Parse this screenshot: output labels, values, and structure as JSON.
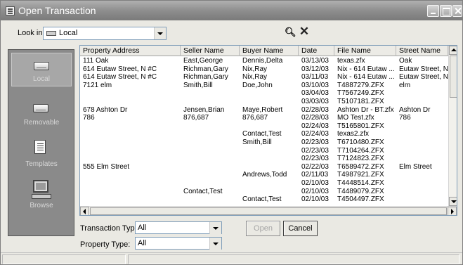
{
  "window": {
    "title": "Open Transaction"
  },
  "toolbar": {
    "lookin_label": "Look in:",
    "lookin_value": "Local",
    "find_icon": "binoculars-icon",
    "delete_icon": "delete-x-icon"
  },
  "places": [
    {
      "label": "Local",
      "icon": "local-drive-icon",
      "active": true
    },
    {
      "label": "Removable",
      "icon": "removable-drive-icon",
      "active": false
    },
    {
      "label": "Templates",
      "icon": "templates-icon",
      "active": false
    },
    {
      "label": "Browse",
      "icon": "browse-computer-icon",
      "active": false
    }
  ],
  "columns": [
    "Property Address",
    "Seller Name",
    "Buyer Name",
    "Date",
    "File Name",
    "Street Name"
  ],
  "rows": [
    [
      "111 Oak",
      "East,George",
      "Dennis,Delta",
      "03/13/03",
      "texas.zfx",
      "Oak"
    ],
    [
      "614 Eutaw Street, N #C",
      "Richman,Gary",
      "Nix,Ray",
      "03/12/03",
      "Nix - 614 Eutaw ...",
      "Eutaw Street, N #C"
    ],
    [
      "614 Eutaw Street, N #C",
      "Richman,Gary",
      "Nix,Ray",
      "03/11/03",
      "Nix - 614 Eutaw ...",
      "Eutaw Street, N #C"
    ],
    [
      "7121 elm",
      "Smith,Bill",
      "Doe,John",
      "03/10/03",
      "T4887279.ZFX",
      "elm"
    ],
    [
      "",
      "",
      "",
      "03/04/03",
      "T7567249.ZFX",
      ""
    ],
    [
      "",
      "",
      "",
      "03/03/03",
      "T5107181.ZFX",
      ""
    ],
    [
      "678 Ashton Dr",
      "Jensen,Brian",
      "Maye,Robert",
      "02/28/03",
      "Ashton Dr - BT.zfx",
      "Ashton Dr"
    ],
    [
      "786",
      "876,687",
      "876,687",
      "02/28/03",
      "MO Test.zfx",
      "786"
    ],
    [
      "",
      "",
      "",
      "02/24/03",
      "T5165801.ZFX",
      ""
    ],
    [
      "",
      "",
      "Contact,Test",
      "02/24/03",
      "texas2.zfx",
      ""
    ],
    [
      "",
      "",
      "Smith,Bill",
      "02/23/03",
      "T6710480.ZFX",
      ""
    ],
    [
      "",
      "",
      "",
      "02/23/03",
      "T7104264.ZFX",
      ""
    ],
    [
      "",
      "",
      "",
      "02/23/03",
      "T7124823.ZFX",
      ""
    ],
    [
      "555 Elm Street",
      "",
      "",
      "02/22/03",
      "T6589472.ZFX",
      "Elm Street"
    ],
    [
      "",
      "",
      "Andrews,Todd",
      "02/11/03",
      "T4987921.ZFX",
      ""
    ],
    [
      "",
      "",
      "",
      "02/10/03",
      "T4448514.ZFX",
      ""
    ],
    [
      "",
      "Contact,Test",
      "",
      "02/10/03",
      "T4489079.ZFX",
      ""
    ],
    [
      "",
      "",
      "Contact,Test",
      "02/10/03",
      "T4504497.ZFX",
      ""
    ]
  ],
  "filters": {
    "transaction_type_label": "Transaction Type:",
    "transaction_type_value": "All",
    "property_type_label": "Property Type:",
    "property_type_value": "All"
  },
  "buttons": {
    "open_label": "Open",
    "cancel_label": "Cancel"
  }
}
